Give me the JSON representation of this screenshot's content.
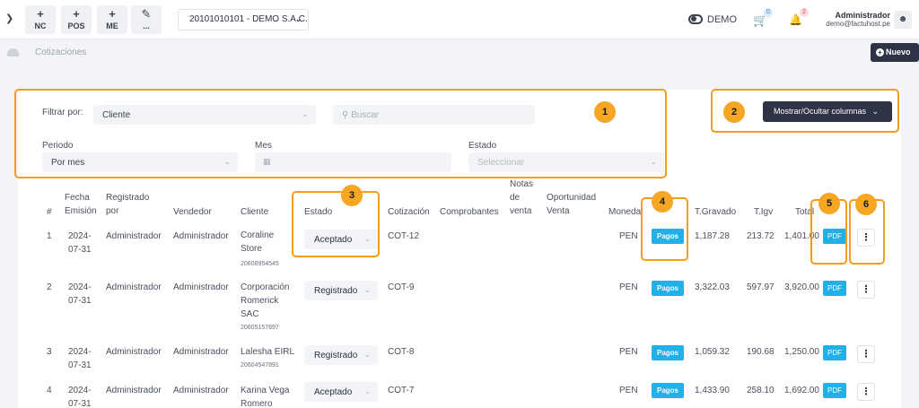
{
  "header": {
    "quick_actions": [
      {
        "symbol": "+",
        "label": "NC"
      },
      {
        "symbol": "+",
        "label": "POS"
      },
      {
        "symbol": "+",
        "label": "ME"
      },
      {
        "symbol": "✎",
        "label": "..."
      }
    ],
    "company": "20101010101 - DEMO S.A.C.",
    "mode_label": "DEMO",
    "cart_count": "0",
    "notif_count": "2",
    "user_name": "Administrador",
    "user_email": "demo@factuhost.pe"
  },
  "breadcrumb": {
    "page": "Cotizaciones"
  },
  "new_button": "Nuevo",
  "filters": {
    "filter_by_label": "Filtrar por:",
    "filter_by_value": "Cliente",
    "search_placeholder": "Buscar",
    "period_label": "Periodo",
    "period_value": "Por mes",
    "month_label": "Mes",
    "state_label": "Estado",
    "state_placeholder": "Seleccionar"
  },
  "columns_button": "Mostrar/Ocultar columnas",
  "table": {
    "headers": {
      "num": "#",
      "fecha": [
        "Fecha",
        "Emisión"
      ],
      "registrado": [
        "Registrado",
        "por"
      ],
      "vendedor": "Vendedor",
      "cliente": "Cliente",
      "estado": "Estado",
      "cotizacion": "Cotización",
      "comprobantes": "Comprobantes",
      "notas": [
        "Notas",
        "de",
        "venta"
      ],
      "oportunidad": [
        "Oportunidad",
        "Venta"
      ],
      "moneda": "Moneda",
      "gravado": "T.Gravado",
      "igv": "T.Igv",
      "total": "Total"
    },
    "rows": [
      {
        "num": "1",
        "date": [
          "2024-",
          "07-31"
        ],
        "registered_by": "Administrador",
        "seller": "Administrador",
        "client": [
          "Coraline",
          "Store"
        ],
        "ruc": "20608954545",
        "status": "Aceptado",
        "quote": "COT-12",
        "currency": "PEN",
        "payments": "Pagos",
        "gravado": "1,187.28",
        "igv": "213.72",
        "total": "1,401.00",
        "pdf": "PDF"
      },
      {
        "num": "2",
        "date": [
          "2024-",
          "07-31"
        ],
        "registered_by": "Administrador",
        "seller": "Administrador",
        "client": [
          "Corporación",
          "Romerick",
          "SAC"
        ],
        "ruc": "20605157897",
        "status": "Registrado",
        "quote": "COT-9",
        "currency": "PEN",
        "payments": "Pagos",
        "gravado": "3,322.03",
        "igv": "597.97",
        "total": "3,920.00",
        "pdf": "PDF"
      },
      {
        "num": "3",
        "date": [
          "2024-",
          "07-31"
        ],
        "registered_by": "Administrador",
        "seller": "Administrador",
        "client": [
          "Lalesha EIRL"
        ],
        "ruc": "20604547891",
        "status": "Registrado",
        "quote": "COT-8",
        "currency": "PEN",
        "payments": "Pagos",
        "gravado": "1,059.32",
        "igv": "190.68",
        "total": "1,250.00",
        "pdf": "PDF"
      },
      {
        "num": "4",
        "date": [
          "2024-",
          "07-31"
        ],
        "registered_by": "Administrador",
        "seller": "Administrador",
        "client": [
          "Karina Vega",
          "Romero"
        ],
        "ruc": "",
        "status": "Aceptado",
        "quote": "COT-7",
        "currency": "PEN",
        "payments": "Pagos",
        "gravado": "1,433.90",
        "igv": "258.10",
        "total": "1,692.00",
        "pdf": "PDF"
      }
    ]
  },
  "callouts": [
    "1",
    "2",
    "3",
    "4",
    "5",
    "6"
  ],
  "colors": {
    "accent": "#22b0e7",
    "dark": "#2e3346",
    "callout": "#f39b1d"
  }
}
